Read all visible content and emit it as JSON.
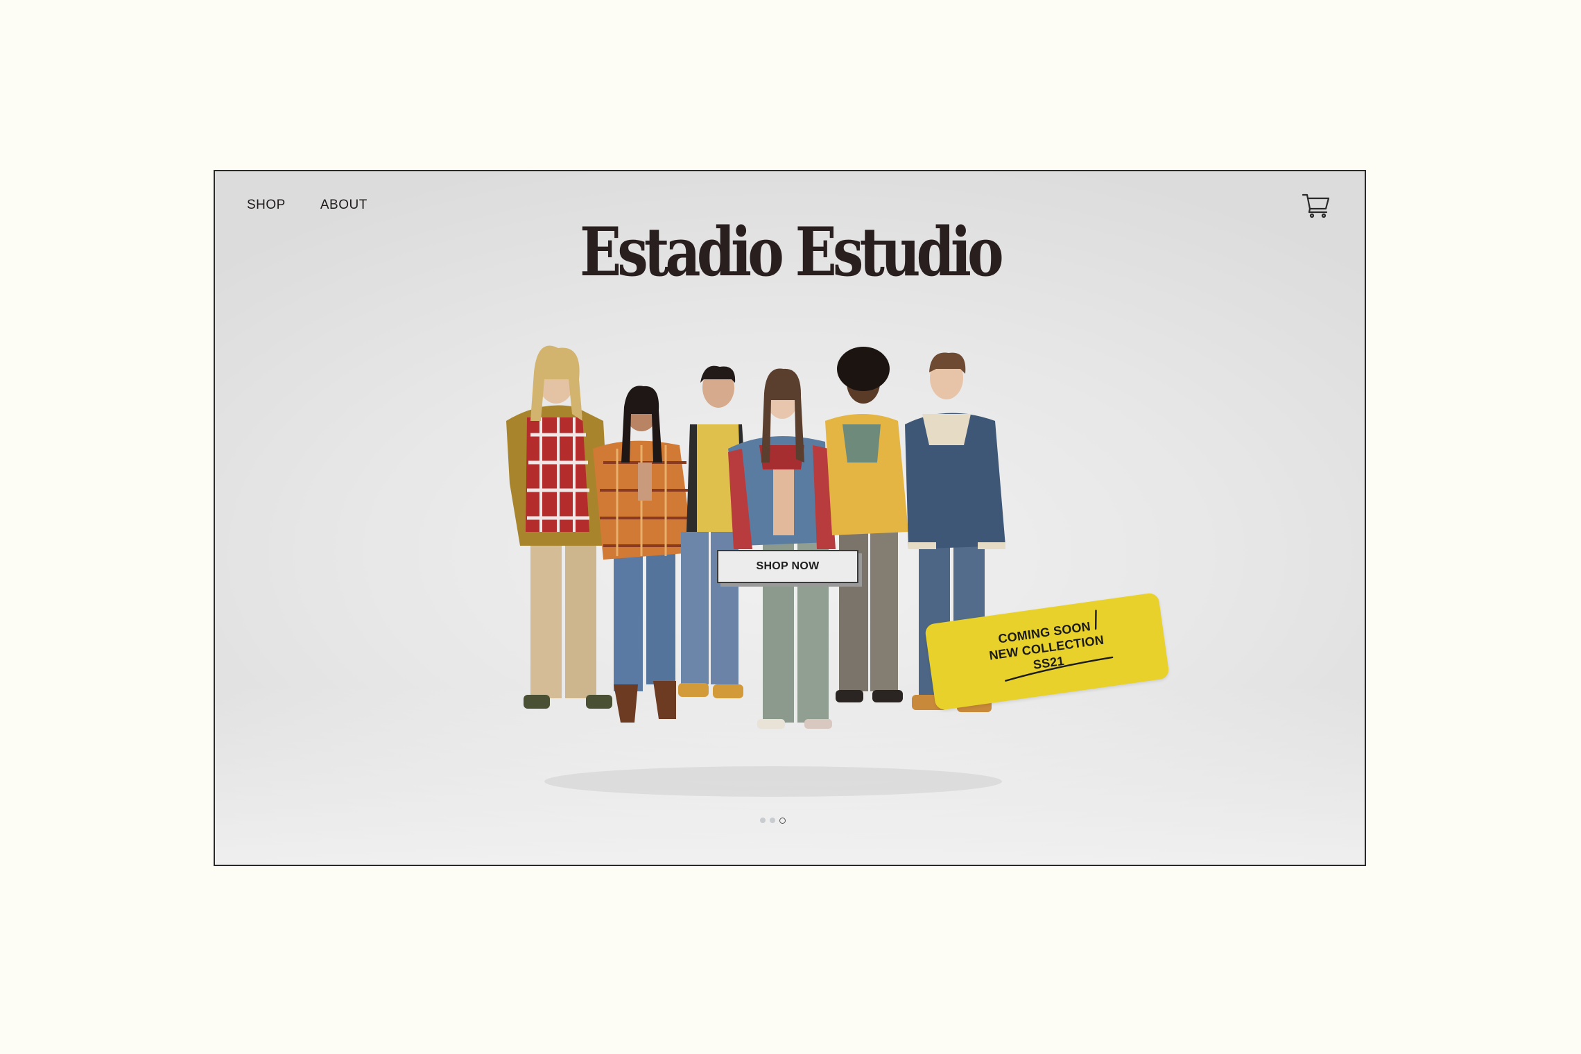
{
  "nav": {
    "items": [
      {
        "label": "SHOP"
      },
      {
        "label": "ABOUT"
      }
    ]
  },
  "brand": {
    "logo_text": "Estadio Estudio"
  },
  "header": {
    "cart_icon": "cart-icon"
  },
  "hero": {
    "cta_label": "SHOP NOW",
    "sticker": {
      "line1": "COMING SOON",
      "line2": "NEW COLLECTION",
      "line3": "SS21",
      "color": "#e8d12a"
    },
    "carousel": {
      "total": 3,
      "active": 3
    }
  },
  "colors": {
    "page_bg": "#fdfcf5",
    "accent_yellow": "#e8d12a",
    "text_dark": "#2a1f1f"
  }
}
